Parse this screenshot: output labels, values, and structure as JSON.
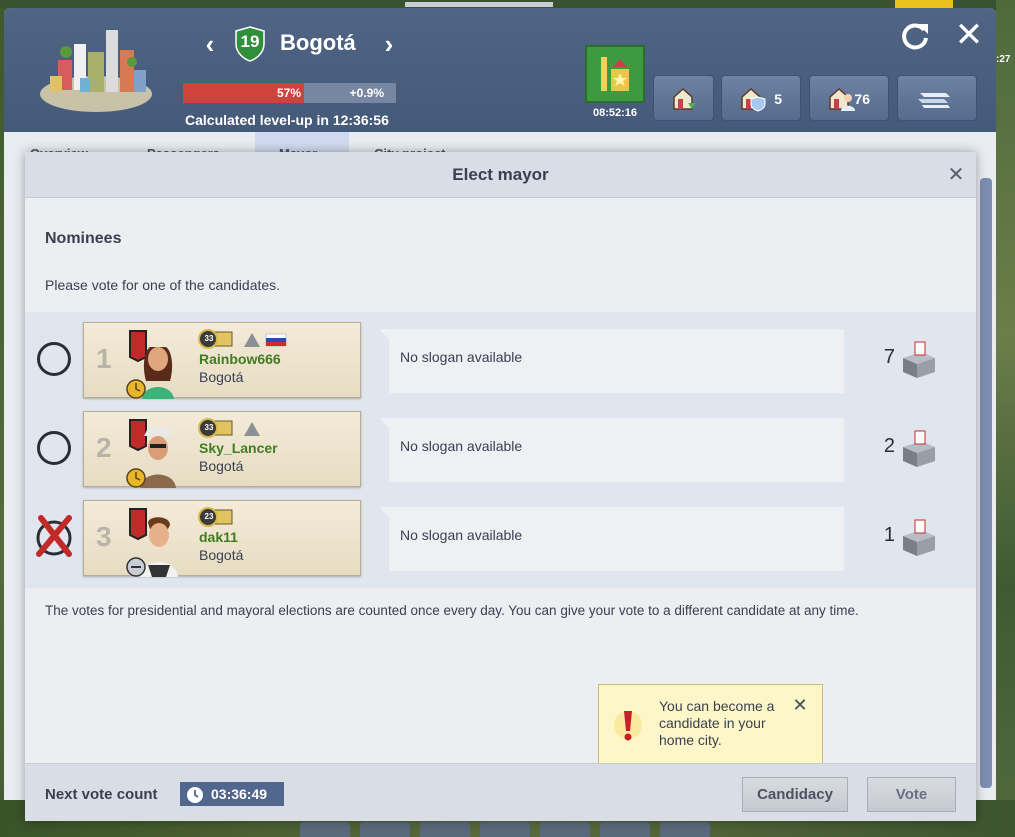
{
  "background": {
    "clock_fragment": ":27"
  },
  "city": {
    "name": "Bogotá",
    "level": "19",
    "progress_percent": 57,
    "progress_label": "57%",
    "progress_delta": "+0.9%",
    "levelup_text": "Calculated level-up in 12:36:56",
    "mayor_timer": "08:52:16",
    "shield_count": "5",
    "passenger_count": "76",
    "tabs": [
      "Overview",
      "Passengers",
      "Mayor",
      "City project"
    ],
    "colors": {
      "header": "#4a5f7e",
      "progress_fill": "#d0423c",
      "level_shield": "#2f8f3a",
      "mayor_bonus": "#3e9a3e"
    }
  },
  "modal": {
    "title": "Elect mayor",
    "nominees_title": "Nominees",
    "instruction": "Please vote for one of the candidates.",
    "nominees": [
      {
        "rank": "1",
        "level": "33",
        "name": "Rainbow666",
        "city": "Bogotá",
        "slogan": "No slogan available",
        "votes": "7",
        "selected": false
      },
      {
        "rank": "2",
        "level": "33",
        "name": "Sky_Lancer",
        "city": "Bogotá",
        "slogan": "No slogan available",
        "votes": "2",
        "selected": false
      },
      {
        "rank": "3",
        "level": "23",
        "name": "dak11",
        "city": "Bogotá",
        "slogan": "No slogan available",
        "votes": "1",
        "selected": true
      }
    ],
    "info": "The votes for presidential and mayoral elections are counted once every day. You can give your vote to a different candidate at any time.",
    "tooltip": "You can become a candidate in your home city.",
    "next_vote_label": "Next vote count",
    "next_vote_timer": "03:36:49",
    "candidacy_label": "Candidacy",
    "vote_label": "Vote"
  }
}
